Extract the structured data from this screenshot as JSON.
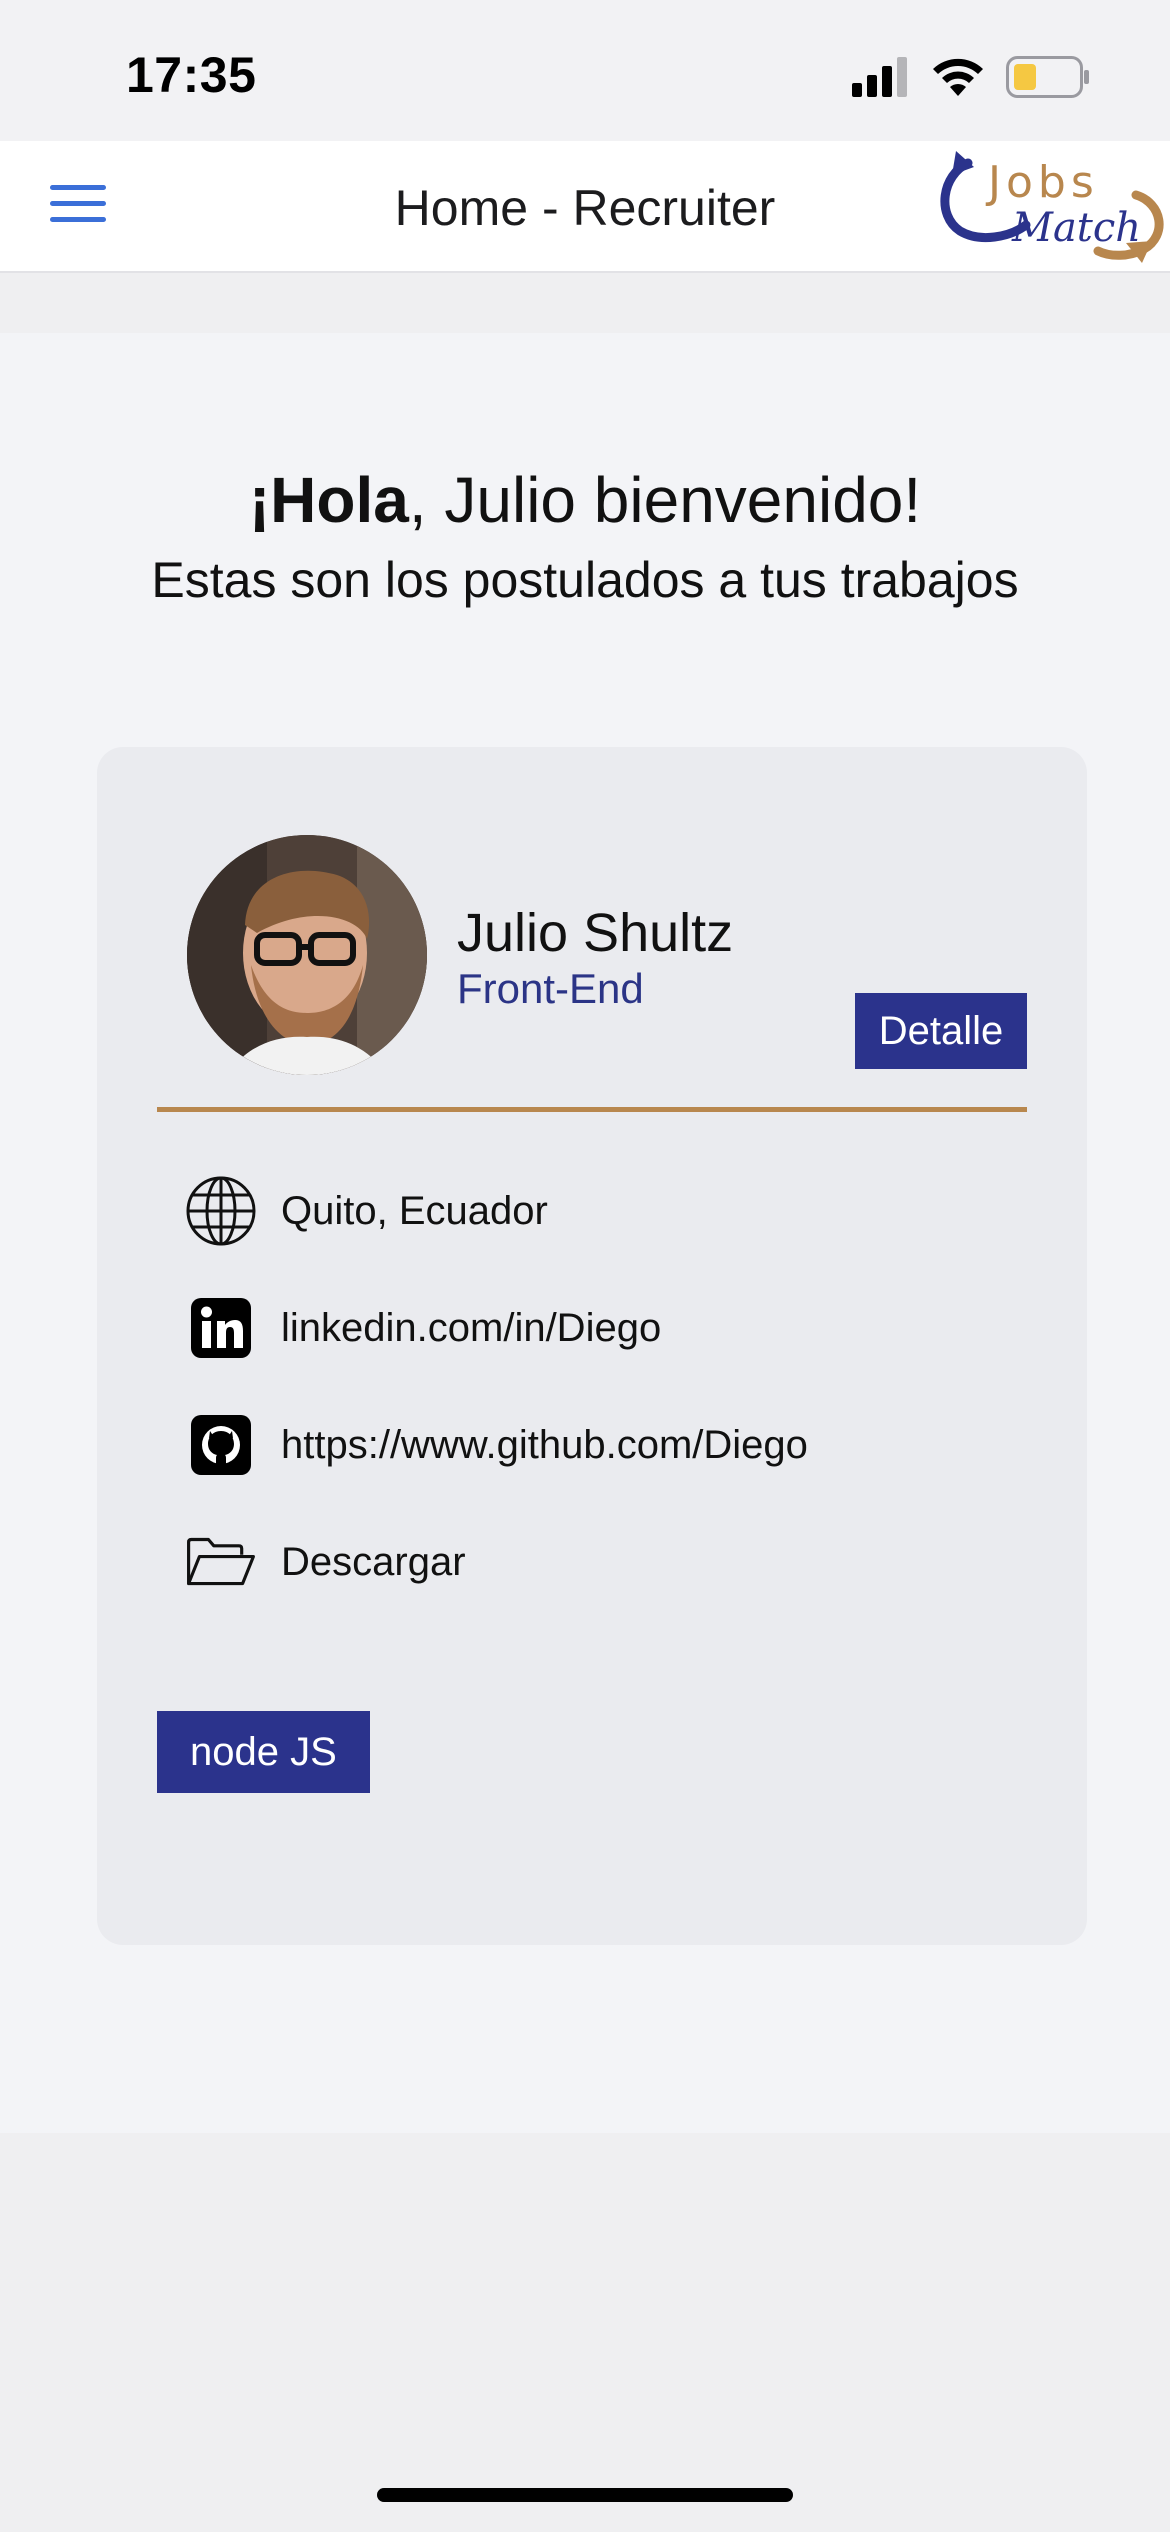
{
  "status_bar": {
    "time": "17:35"
  },
  "header": {
    "title": "Home - Recruiter",
    "menu_icon": "hamburger-menu-icon",
    "logo": {
      "line1": "Jobs",
      "line2": "Match",
      "colors": {
        "blue": "#2b338c",
        "gold": "#b8874e"
      }
    }
  },
  "greeting": {
    "hello": "¡Hola",
    "rest": ", Julio bienvenido!",
    "subtitle": "Estas son los postulados a tus trabajos"
  },
  "candidate_card": {
    "name": "Julio Shultz",
    "role": "Front-End",
    "detail_button": "Detalle",
    "info": [
      {
        "icon": "globe-icon",
        "text": "Quito, Ecuador"
      },
      {
        "icon": "linkedin-icon",
        "text": "linkedin.com/in/Diego"
      },
      {
        "icon": "github-icon",
        "text": "https://www.github.com/Diego"
      },
      {
        "icon": "folder-open-icon",
        "text": "Descargar"
      }
    ],
    "skills": [
      "node JS"
    ]
  },
  "colors": {
    "accent": "#2b338c",
    "divider": "#b8874e",
    "menu": "#3b6fd8",
    "card_bg": "#eaebef"
  }
}
